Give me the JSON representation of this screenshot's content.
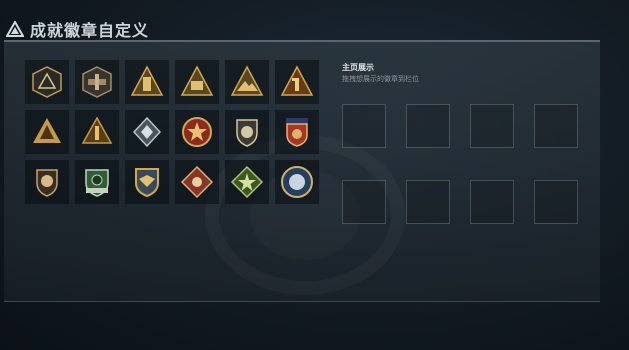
{
  "header": {
    "title": "成就徽章自定义",
    "icon": "triangle-logo-icon"
  },
  "badges": [
    {
      "name": "badge-triangle-emblem",
      "color": "#b89c5a"
    },
    {
      "name": "badge-aircraft",
      "color": "#a08c6a"
    },
    {
      "name": "badge-tower",
      "color": "#b8924a"
    },
    {
      "name": "badge-vehicle",
      "color": "#b8924a"
    },
    {
      "name": "badge-mountain-pass",
      "color": "#c8a050"
    },
    {
      "name": "badge-number-one",
      "color": "#c08a3a"
    },
    {
      "name": "badge-silhouettes",
      "color": "#c49a48"
    },
    {
      "name": "badge-soldier",
      "color": "#c49a48"
    },
    {
      "name": "badge-diamond-hex",
      "color": "#8a9aa4"
    },
    {
      "name": "badge-star-seal",
      "color": "#c43a2a"
    },
    {
      "name": "badge-shield-star",
      "color": "#d0c8a8"
    },
    {
      "name": "badge-stars-ribbon",
      "color": "#b83a2a"
    },
    {
      "name": "badge-lion-shield",
      "color": "#c4a070"
    },
    {
      "name": "badge-green-shield",
      "color": "#3e7a4a"
    },
    {
      "name": "badge-crest-eagle",
      "color": "#c49a48"
    },
    {
      "name": "badge-red-diamond",
      "color": "#b04a3a"
    },
    {
      "name": "badge-green-star",
      "color": "#5a8a3a"
    },
    {
      "name": "badge-blue-wolf",
      "color": "#3a5a7a"
    }
  ],
  "showcase": {
    "title": "主页展示",
    "subtitle": "拖拽想展示的徽章到栏位",
    "slots": 8
  }
}
